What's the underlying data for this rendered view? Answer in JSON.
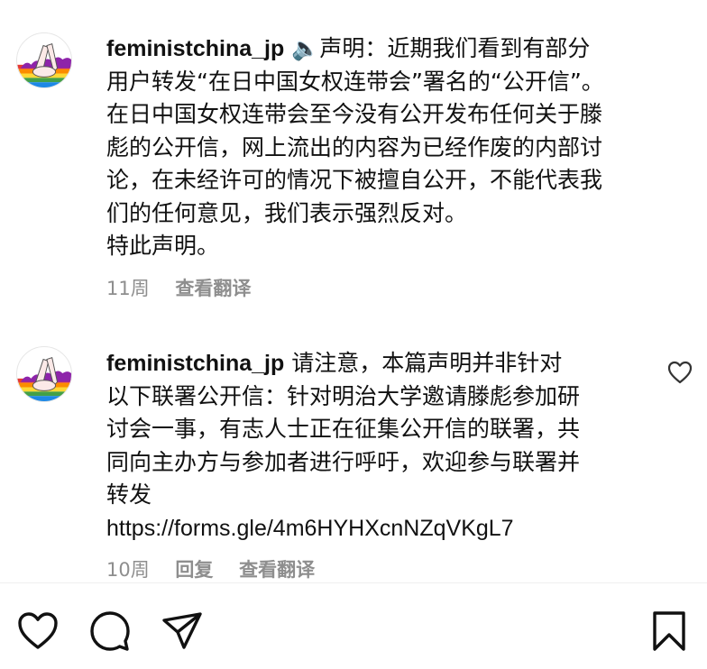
{
  "comments": [
    {
      "username": "feministchina_jp",
      "emoji": "🔈",
      "lines": [
        "声明：近期我们看到有部分",
        "用户转发“在日中国女权连带会”署名的“公开信”。",
        "在日中国女权连带会至今没有公开发布任何关于滕",
        "彪的公开信，网上流出的内容为已经作废的内部讨",
        "论，在未经许可的情况下被擅自公开，不能代表我",
        "们的任何意见，我们表示强烈反对。",
        "特此声明。"
      ],
      "time": "11周",
      "translate": "查看翻译"
    },
    {
      "username": "feministchina_jp",
      "lines": [
        "请注意，本篇声明并非针对",
        "以下联署公开信：针对明治大学邀请滕彪参加研",
        "讨会一事，有志人士正在征集公开信的联署，共",
        "同向主办方与参加者进行呼吁，欢迎参与联署并",
        "转发"
      ],
      "link": "https://forms.gle/4m6HYHXcnNZqVKgL7",
      "time": "10周",
      "reply": "回复",
      "translate": "查看翻译"
    }
  ],
  "action_bar": {
    "icons": [
      "heart-icon",
      "comment-icon",
      "share-icon",
      "bookmark-icon"
    ]
  }
}
